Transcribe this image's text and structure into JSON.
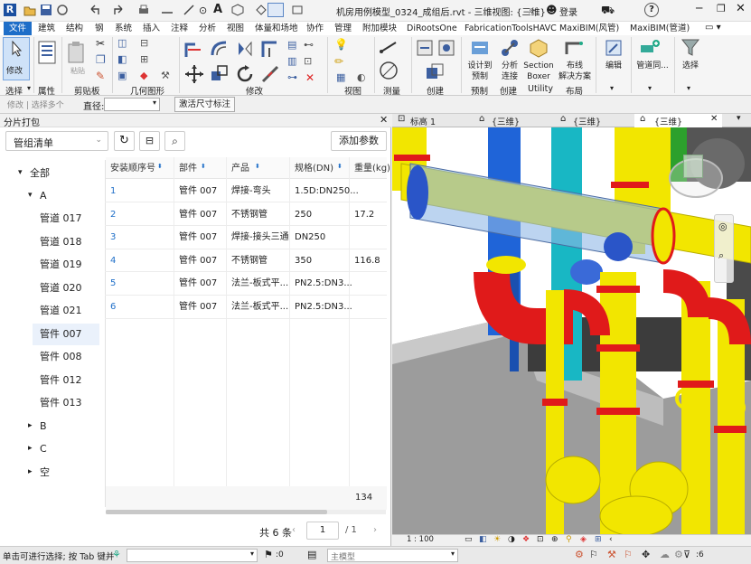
{
  "window": {
    "title": "机房用例模型_0324_成组后.rvt - 三维视图: {三维}",
    "login": "登录",
    "help": "?"
  },
  "ribbon_tabs": [
    "文件",
    "建筑",
    "结构",
    "钢",
    "系统",
    "插入",
    "注释",
    "分析",
    "视图",
    "体量和场地",
    "协作",
    "管理",
    "附加模块",
    "DiRootsOne",
    "FabricationToolsHAVC",
    "MaxiBIM(风管)",
    "MaxiBIM(管道)"
  ],
  "ribbon": {
    "modify": "修改",
    "panels": [
      "选择",
      "属性",
      "剪贴板",
      "几何图形",
      "修改",
      "视图",
      "测量",
      "创建"
    ],
    "big_buttons": [
      {
        "l1": "设计到",
        "l2": "预制"
      },
      {
        "l1": "分析",
        "l2": "连接"
      },
      {
        "l1": "Section",
        "l2": "Boxer"
      },
      {
        "l1": "布线",
        "l2": "解决方案"
      },
      {
        "l1": "编辑",
        "l2": ""
      },
      {
        "l1": "管道同...",
        "l2": ""
      },
      {
        "l1": "选择",
        "l2": ""
      }
    ],
    "bottom_labels": [
      "预制",
      "创建",
      "Utility",
      "布局"
    ]
  },
  "options_bar": {
    "modify_label": "修改 | 选择多个",
    "diameter_label": "直径:",
    "activate_dim": "激活尺寸标注"
  },
  "left_panel": {
    "title": "分片打包",
    "dropdown_value": "管组清单",
    "add_param": "添加参数",
    "tree": [
      {
        "label": "全部",
        "level": 0,
        "arrow": "▾"
      },
      {
        "label": "A",
        "level": 1,
        "arrow": "▾"
      },
      {
        "label": "管道 017",
        "level": 2
      },
      {
        "label": "管道 018",
        "level": 2
      },
      {
        "label": "管道 019",
        "level": 2
      },
      {
        "label": "管道 020",
        "level": 2
      },
      {
        "label": "管道 021",
        "level": 2
      },
      {
        "label": "管件 007",
        "level": 2,
        "selected": true
      },
      {
        "label": "管件 008",
        "level": 2
      },
      {
        "label": "管件 012",
        "level": 2
      },
      {
        "label": "管件 013",
        "level": 2
      },
      {
        "label": "B",
        "level": 1,
        "arrow": "▸"
      },
      {
        "label": "C",
        "level": 1,
        "arrow": "▸"
      },
      {
        "label": "空",
        "level": 1,
        "arrow": "▸"
      }
    ],
    "table": {
      "headers": [
        "安装顺序号",
        "部件",
        "产品",
        "规格(DN)",
        "重量(kg)"
      ],
      "rows": [
        [
          "1",
          "管件 007",
          "焊接-弯头",
          "1.5D:DN250...",
          ""
        ],
        [
          "2",
          "管件 007",
          "不锈钢管",
          "250",
          "17.2"
        ],
        [
          "3",
          "管件 007",
          "焊接-接头三通",
          "DN250",
          ""
        ],
        [
          "4",
          "管件 007",
          "不锈钢管",
          "350",
          "116.8"
        ],
        [
          "5",
          "管件 007",
          "法兰-板式平...",
          "PN2.5:DN3...",
          ""
        ],
        [
          "6",
          "管件 007",
          "法兰-板式平...",
          "PN2.5:DN3...",
          ""
        ]
      ],
      "total_weight": "134"
    },
    "pagination": {
      "total": "共 6 条",
      "page": "1",
      "pages": "/ 1"
    }
  },
  "view_tabs": [
    {
      "label": "标高 1"
    },
    {
      "label": "{三维}"
    },
    {
      "label": "{三维}"
    },
    {
      "label": "{三维}",
      "active": true
    }
  ],
  "view_bar": {
    "scale": "1 : 100"
  },
  "status": {
    "hint": "单击可进行选择; 按 Tab 键并",
    "count": ":0",
    "model": "主模型",
    "filter_count": ":6"
  },
  "colors": {
    "accent": "#1e6ec8",
    "yellow_pipe": "#f2e600",
    "red_fitting": "#e01a1a",
    "blue_pipe": "#1f64d8",
    "cyan_pipe": "#18b7c4",
    "green_pipe": "#2ca02c"
  }
}
